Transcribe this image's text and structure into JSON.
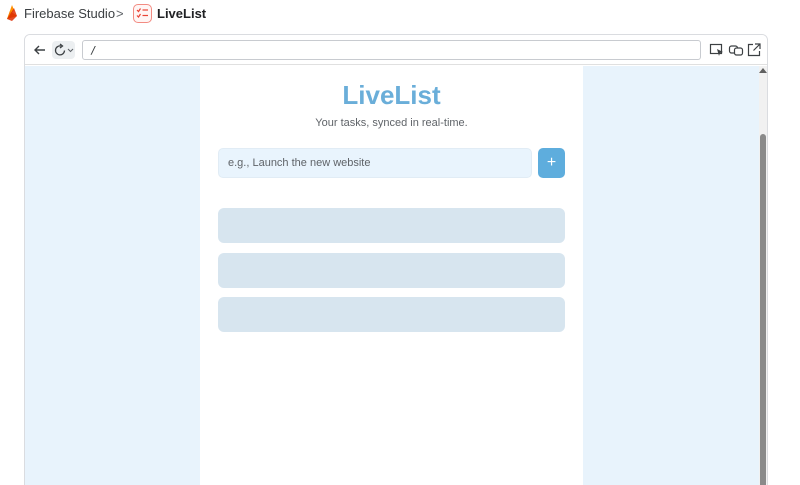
{
  "header": {
    "app_name": "Firebase Studio",
    "separator": ">",
    "project_name": "LiveList",
    "icons": [
      "firebase-flame-icon",
      "checklist-icon"
    ]
  },
  "browser": {
    "url": "/",
    "icons": [
      "back-arrow-icon",
      "reload-icon",
      "chevron-down-icon",
      "inspect-icon",
      "duplicate-icon",
      "open-external-icon"
    ]
  },
  "app": {
    "title": "LiveList",
    "subtitle": "Your tasks, synced in real-time.",
    "input_placeholder": "e.g., Launch the new website",
    "input_value": "",
    "add_button_label": "+",
    "loading_placeholders": 3
  },
  "colors": {
    "accent": "#5eaddd",
    "page_background": "#e8f3fc",
    "card_background": "#ffffff",
    "skeleton": "#d7e5ef"
  }
}
